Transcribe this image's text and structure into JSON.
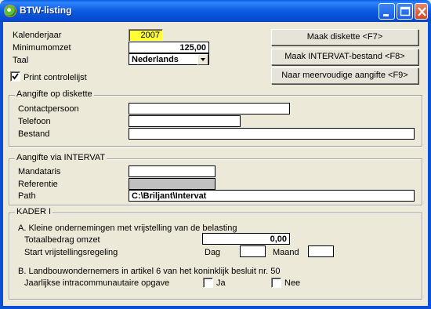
{
  "window": {
    "title": "BTW-listing"
  },
  "form": {
    "kalenderjaar_label": "Kalenderjaar",
    "kalenderjaar_value": "2007",
    "minimumomzet_label": "Minimumomzet",
    "minimumomzet_value": "125,00",
    "taal_label": "Taal",
    "taal_value": "Nederlands",
    "print_label": "Print controlelijst",
    "print_checked": true
  },
  "buttons": {
    "diskette": "Maak diskette <F7>",
    "intervat": "Maak INTERVAT-bestand <F8>",
    "meervoudige": "Naar meervoudige aangifte <F9>"
  },
  "diskette_group": {
    "title": "Aangifte op diskette",
    "contact_label": "Contactpersoon",
    "contact_value": "",
    "telefoon_label": "Telefoon",
    "telefoon_value": "",
    "bestand_label": "Bestand",
    "bestand_value": ""
  },
  "intervat_group": {
    "title": "Aangifte via INTERVAT",
    "mandataris_label": "Mandataris",
    "mandataris_value": "",
    "referentie_label": "Referentie",
    "referentie_value": "",
    "path_label": "Path",
    "path_value": "C:\\Briljant\\Intervat"
  },
  "kader_group": {
    "title": "KADER I",
    "section_a": "A. Kleine ondernemingen met vrijstelling van de belasting",
    "totaal_label": "Totaalbedrag omzet",
    "totaal_value": "0,00",
    "start_label": "Start vrijstellingsregeling",
    "dag_label": "Dag",
    "dag_value": "",
    "maand_label": "Maand",
    "maand_value": "",
    "section_b": "B. Landbouwondernemers in artikel 6 van het koninklijk besluit nr. 50",
    "jaarlijkse_label": "Jaarlijkse intracommunautaire opgave",
    "ja_label": "Ja",
    "nee_label": "Nee"
  },
  "icons": [
    "app-icon",
    "minimize-icon",
    "maximize-icon",
    "close-icon",
    "checkmark-icon",
    "dropdown-arrow-icon"
  ]
}
